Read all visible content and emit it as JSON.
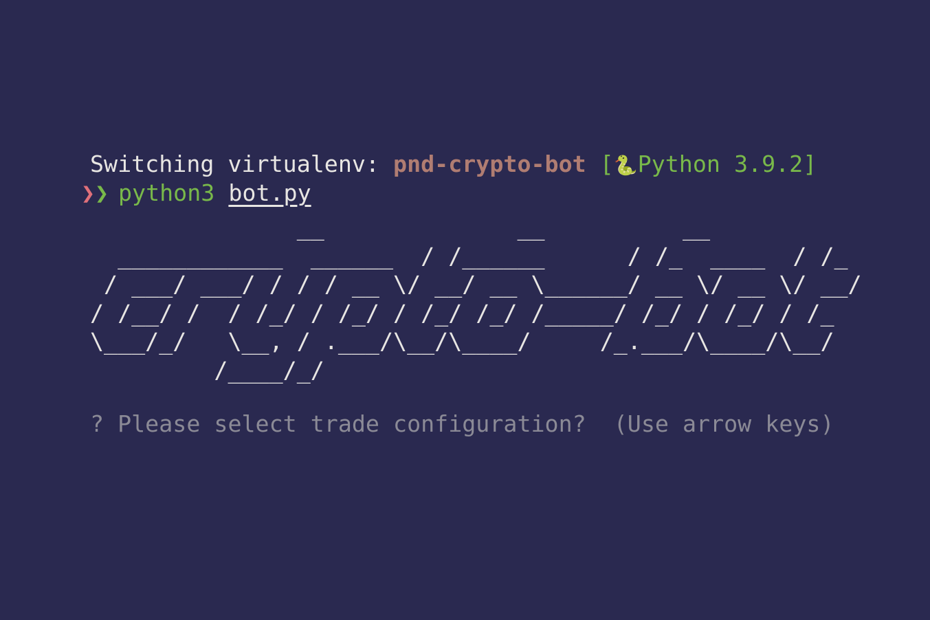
{
  "colors": {
    "background": "#2a2950",
    "foreground": "#e8e6e3",
    "env_name": "#b07d72",
    "green": "#79b94a",
    "prompt_red": "#e0707a",
    "dim": "#8b8a96"
  },
  "status_line": {
    "prefix": "Switching virtualenv: ",
    "env_name": "pnd-crypto-bot",
    "bracket_open": " [",
    "snake_icon": "🐍",
    "python_label": "Python 3.9.2",
    "bracket_close": "]"
  },
  "command_line": {
    "prompt_a": "❯",
    "prompt_b": "❯",
    "command": "python3",
    "argument": "bot.py"
  },
  "banner": "               __              __          __\n  ____________  ______  / /______      / /_  ____  / /_\n / ___/ ___/ / / / __ \\/ __/ __ \\______/ __ \\/ __ \\/ __/\n/ /__/ /  / /_/ / /_/ / /_/ /_/ /_____/ /_/ / /_/ / /_\n\\___/_/   \\__, / .___/\\__/\\____/     /_.___/\\____/\\__/\n         /____/_/",
  "question": "? Please select trade configuration?  (Use arrow keys)"
}
